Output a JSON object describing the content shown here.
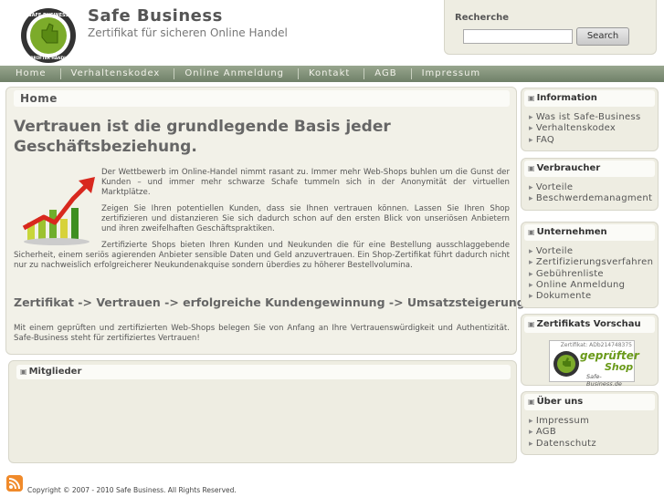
{
  "header": {
    "title": "Safe Business",
    "slogan": "Zertifikat für sicheren Online Handel",
    "logo_top_text": "SAFE BUSINESS",
    "logo_bottom_text": "GEPRÜFTER HÄNDLER"
  },
  "search": {
    "label": "Recherche",
    "value": "",
    "button": "Search"
  },
  "nav": {
    "items": [
      "Home",
      "Verhaltenskodex",
      "Online Anmeldung",
      "Kontakt",
      "AGB",
      "Impressum"
    ]
  },
  "main": {
    "breadcrumb": "Home",
    "headline": "Vertrauen ist die grundlegende Basis jeder Geschäftsbeziehung.",
    "paragraphs": [
      "Der Wettbewerb im Online-Handel nimmt rasant zu. Immer mehr Web-Shops buhlen um die Gunst der Kunden – und immer mehr schwarze Schafe tummeln sich in der Anonymität der virtuellen Marktplätze.",
      "Zeigen Sie Ihren potentiellen Kunden, dass sie Ihnen vertrauen können. Lassen Sie Ihren Shop zertifizieren und distanzieren Sie sich dadurch schon auf den ersten Blick von unseriösen Anbietern und ihren zweifelhaften Geschäftspraktiken.",
      "Zertifizierte Shops bieten Ihren Kunden und Neukunden die für eine Bestellung ausschlaggebende Sicherheit, einem seriös agierenden Anbieter sensible Daten und Geld anzuvertrauen. Ein Shop-Zertifikat führt dadurch nicht nur zu nachweislich erfolgreicherer Neukundenakquise sondern überdies zu höherer Bestellvolumina.",
      "Mit einem geprüften und zertifizierten Web-Shops belegen Sie von Anfang an Ihre Vertrauenswürdigkeit und Authentizität. Safe-Business steht für zertifiziertes Vertrauen!"
    ],
    "subheadline": "Zertifikat -> Vertrauen -> erfolgreiche Kundengewinnung -> Umsatzsteigerung"
  },
  "members": {
    "title": "Mitglieder"
  },
  "sidebar": {
    "information": {
      "title": "Information",
      "items": [
        "Was ist Safe-Business",
        "Verhaltenskodex",
        "FAQ"
      ]
    },
    "verbraucher": {
      "title": "Verbraucher",
      "items": [
        "Vorteile",
        "Beschwerdemanagment"
      ]
    },
    "unternehmen": {
      "title": "Unternehmen",
      "items": [
        "Vorteile",
        "Zertifizierungsverfahren",
        "Gebührenliste",
        "Online Anmeldung",
        "Dokumente"
      ]
    },
    "vorschau": {
      "title": "Zertifikats Vorschau",
      "badge_id": "Zertifikat: ADb214748375",
      "badge_line1": "geprüfter",
      "badge_line2": "Shop",
      "badge_line3": "Safe-Business.de"
    },
    "ueber": {
      "title": "Über uns",
      "items": [
        "Impressum",
        "AGB",
        "Datenschutz"
      ]
    }
  },
  "footer": {
    "copyright": "Copyright © 2007 - 2010 Safe Business. All Rights Reserved."
  },
  "colors": {
    "nav_bg": "#7d8e74",
    "panel_bg": "#f2f1e8",
    "accent_green": "#6a9a1a"
  }
}
